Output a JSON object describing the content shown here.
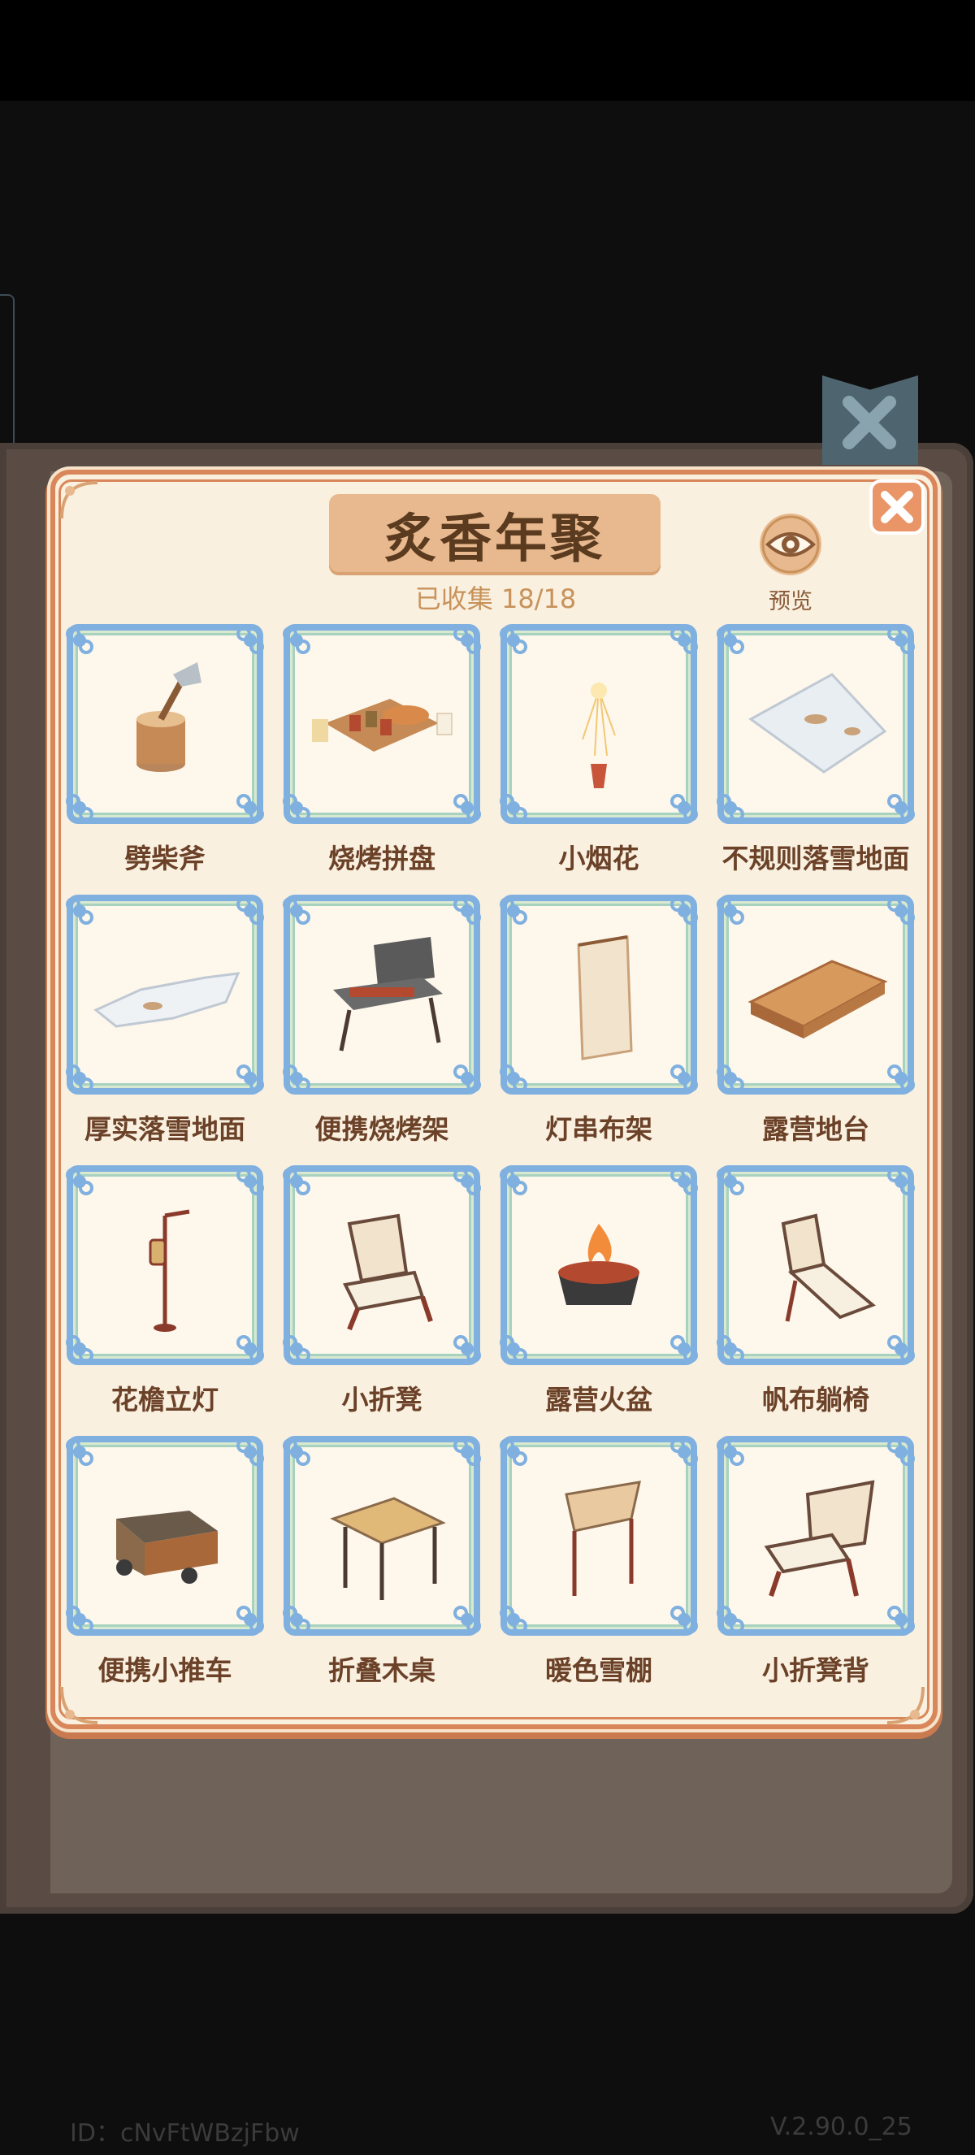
{
  "panel": {
    "title": "炙香年聚",
    "collected": "已收集 18/18",
    "preview_label": "预览"
  },
  "items": [
    {
      "label": "劈柴斧"
    },
    {
      "label": "烧烤拼盘"
    },
    {
      "label": "小烟花"
    },
    {
      "label": "不规则落雪地面"
    },
    {
      "label": "厚实落雪地面"
    },
    {
      "label": "便携烧烤架"
    },
    {
      "label": "灯串布架"
    },
    {
      "label": "露营地台"
    },
    {
      "label": "花檐立灯"
    },
    {
      "label": "小折凳"
    },
    {
      "label": "露营火盆"
    },
    {
      "label": "帆布躺椅"
    },
    {
      "label": "便携小推车"
    },
    {
      "label": "折叠木桌"
    },
    {
      "label": "暖色雪棚"
    },
    {
      "label": "小折凳背"
    }
  ],
  "footer": {
    "id": "ID：cNvFtWBzjFbw",
    "version": "V.2.90.0_25"
  },
  "colors": {
    "panel_bg": "#f9f0e0",
    "panel_border": "#d9875a",
    "title_plate": "#e8b98f",
    "frame_blue": "#7fb0e0",
    "label_brown": "#6b4128"
  }
}
